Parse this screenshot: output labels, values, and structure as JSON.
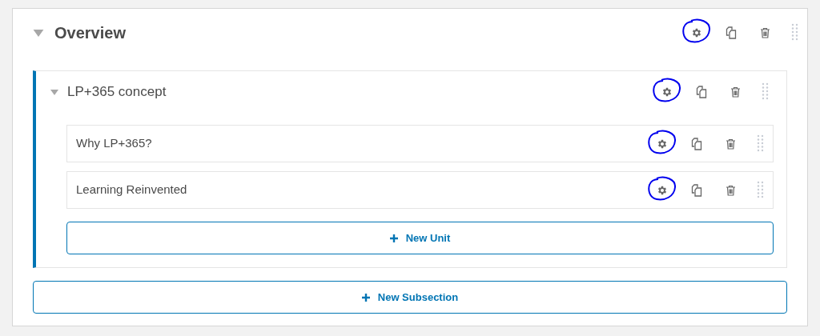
{
  "section": {
    "title": "Overview",
    "expanded": true,
    "gear_circled": true,
    "subsections": [
      {
        "title": "LP+365 concept",
        "expanded": true,
        "gear_circled": true,
        "units": [
          {
            "title": "Why LP+365?",
            "gear_circled": true
          },
          {
            "title": "Learning Reinvented",
            "gear_circled": true
          }
        ],
        "new_unit_button": "New Unit"
      }
    ],
    "new_subsection_button": "New Subsection"
  }
}
